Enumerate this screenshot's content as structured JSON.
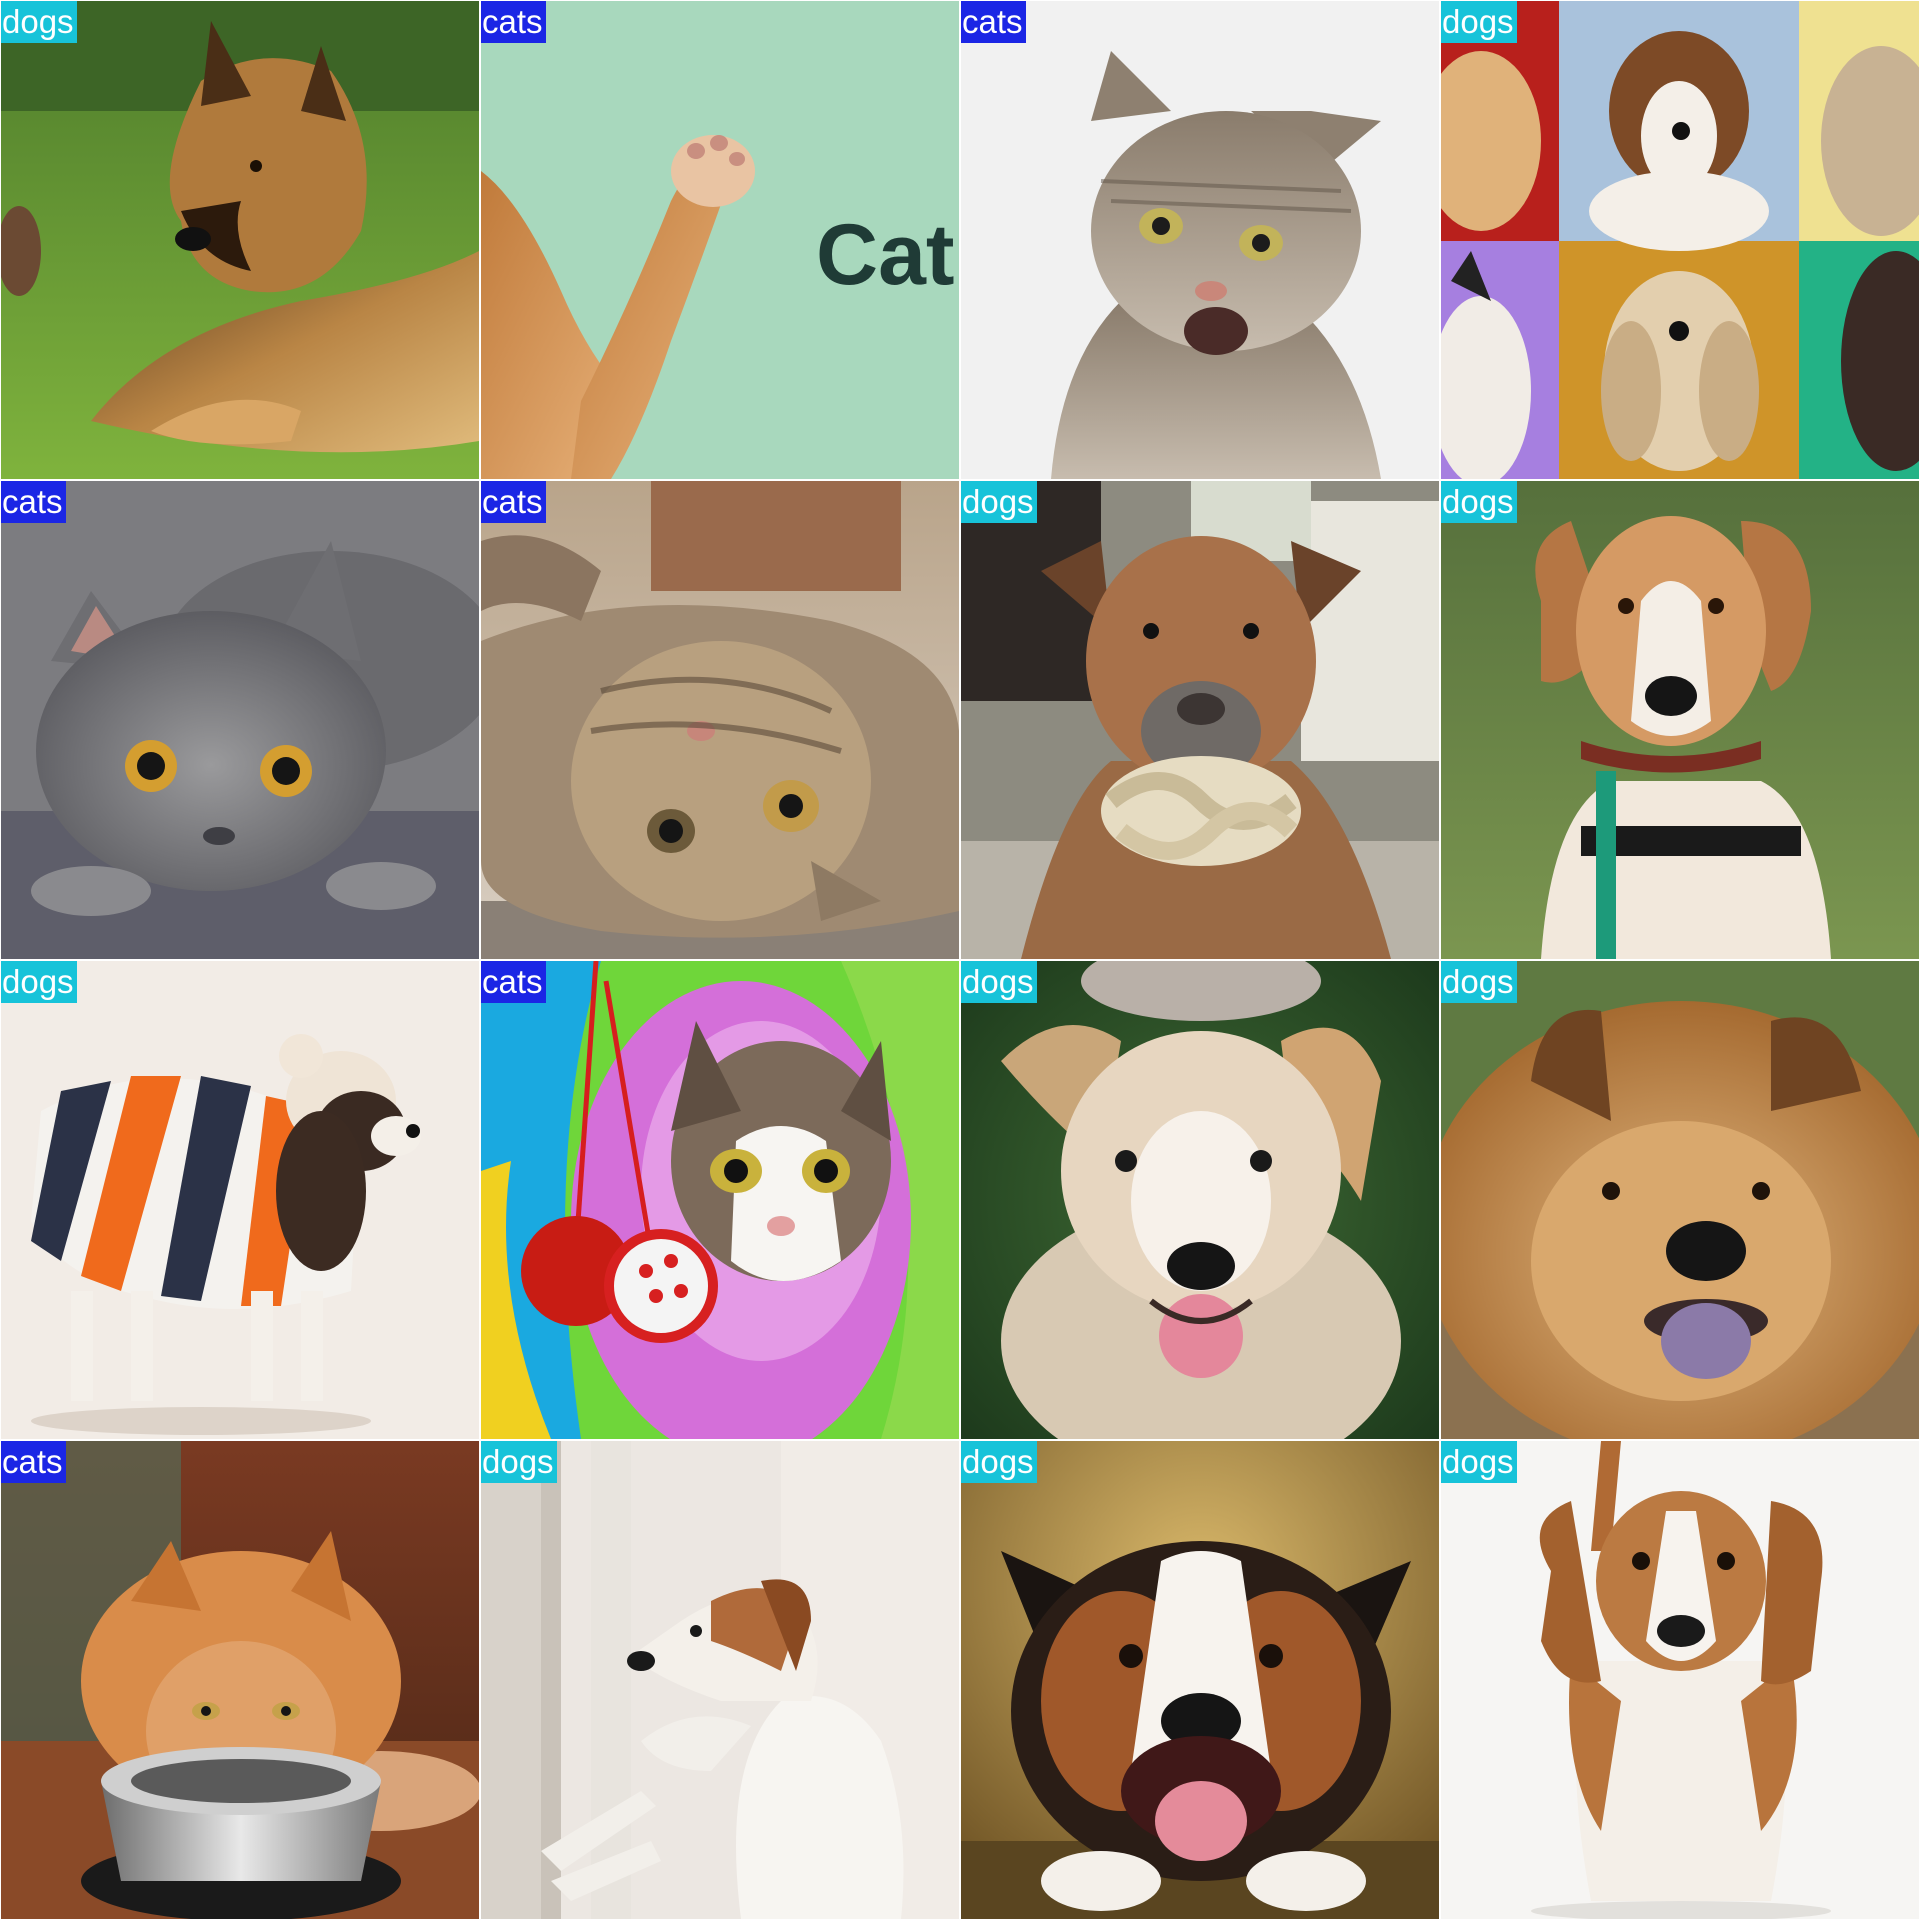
{
  "grid": {
    "tiles": [
      {
        "label": "dogs",
        "scene": "german-shepherd-on-grass"
      },
      {
        "label": "cats",
        "scene": "orange-cat-paw-raised",
        "overlay_text": "Cat"
      },
      {
        "label": "cats",
        "scene": "tabby-cat-mouth-open"
      },
      {
        "label": "dogs",
        "scene": "dog-portrait-collage"
      },
      {
        "label": "cats",
        "scene": "gray-cat-lying"
      },
      {
        "label": "cats",
        "scene": "tabby-cat-on-back"
      },
      {
        "label": "dogs",
        "scene": "pitbull-with-rope-toy"
      },
      {
        "label": "dogs",
        "scene": "hound-with-collar-on-turf"
      },
      {
        "label": "dogs",
        "scene": "spaniel-in-striped-sweater"
      },
      {
        "label": "cats",
        "scene": "cat-in-play-tunnel-with-balls"
      },
      {
        "label": "dogs",
        "scene": "puppy-looking-up"
      },
      {
        "label": "dogs",
        "scene": "chow-chow-tongue-out"
      },
      {
        "label": "cats",
        "scene": "ginger-cat-eating-from-bowl"
      },
      {
        "label": "dogs",
        "scene": "jack-russell-at-window"
      },
      {
        "label": "dogs",
        "scene": "border-collie-smiling"
      },
      {
        "label": "dogs",
        "scene": "beagle-standing"
      }
    ]
  },
  "colors": {
    "dogs_label_bg": "#17C3D9",
    "cats_label_bg": "#1B26E5",
    "label_text": "#FFFFFF"
  }
}
